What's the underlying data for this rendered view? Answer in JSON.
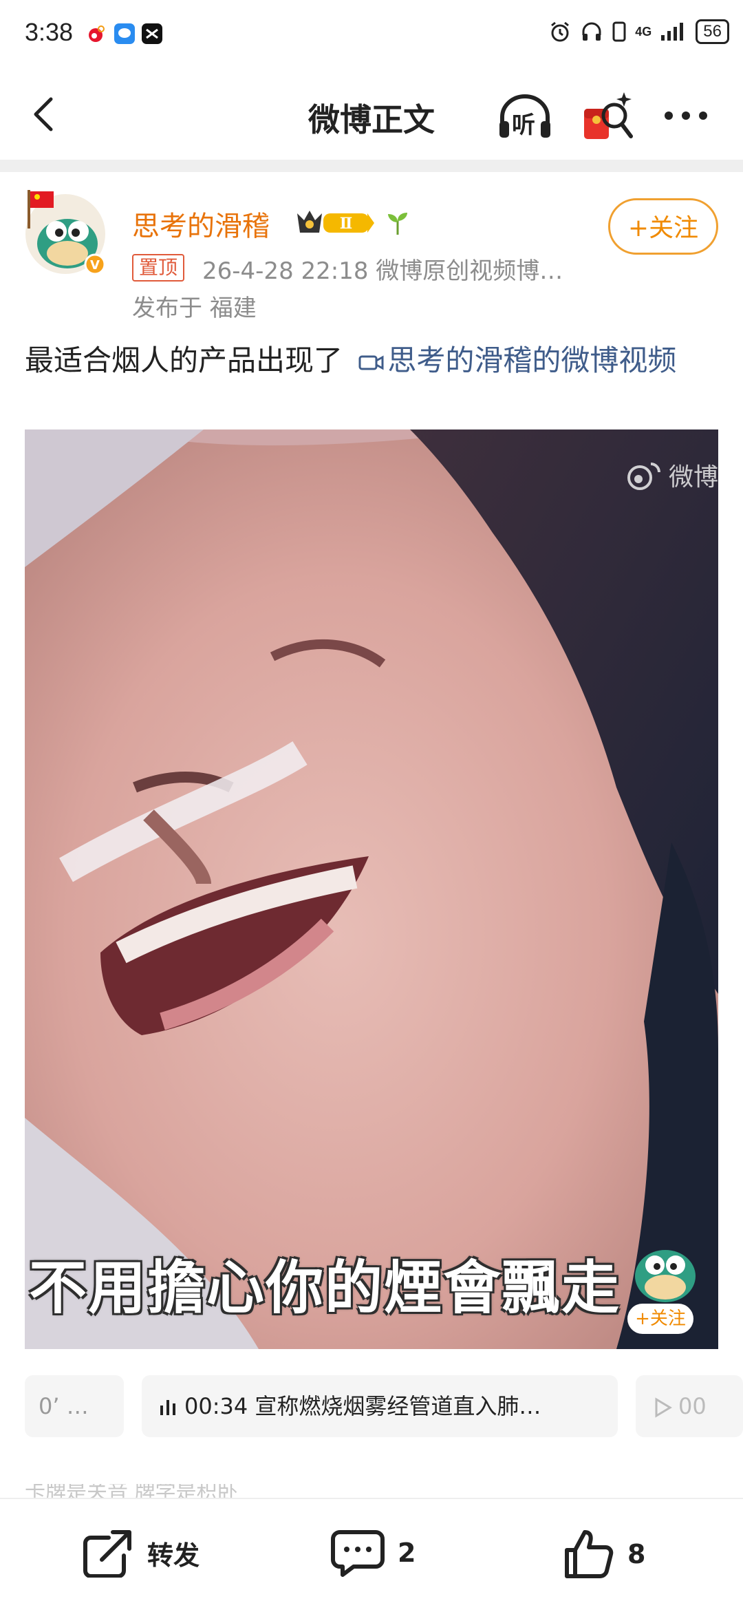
{
  "status_bar": {
    "time": "3:38",
    "network": "4G",
    "battery": "56"
  },
  "nav": {
    "title": "微博正文",
    "listen_label": "听"
  },
  "post": {
    "author": "思考的滑稽",
    "pin_label": "置顶",
    "meta": "26-4-28 22:18  微博原创视频博…",
    "location": "发布于 福建",
    "follow_label": "+关注",
    "text": "最适合烟人的产品出现了",
    "video_link_text": "思考的滑稽的微博视频"
  },
  "video": {
    "watermark": "微博",
    "subtitle": "不用擔心你的煙會飄走",
    "follow_label": "+关注"
  },
  "chapters": {
    "left": "0’ …",
    "main": "00:34 宣称燃烧烟雾经管道直入肺…",
    "right": "00"
  },
  "faded_text": "卡牌是关音   牌学是积卧",
  "actions": {
    "repost_label": "转发",
    "comment_count": "2",
    "like_count": "8"
  },
  "colors": {
    "username": "#e8730a",
    "follow_border": "#f0a030",
    "link": "#3f5c8a",
    "meta": "#8c8c8c"
  }
}
